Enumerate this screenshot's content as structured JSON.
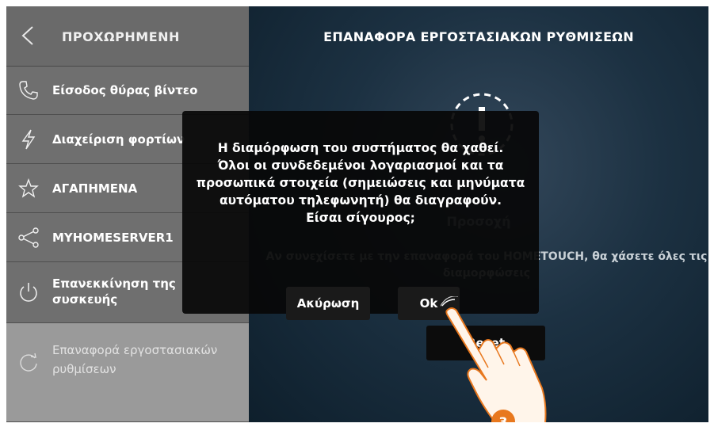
{
  "sidebar": {
    "title": "ΠΡΟΧΩΡΗΜΕΝΗ",
    "back_icon": "chevron-left-icon",
    "items": [
      {
        "label": "Είσοδος θύρας βίντεο",
        "icon": "phone-icon"
      },
      {
        "label": "Διαχείριση φορτίων",
        "icon": "lightning-icon"
      },
      {
        "label": "ΑΓΑΠΗΜΕΝΑ",
        "icon": "star-icon"
      },
      {
        "label": "MYHOMESERVER1",
        "icon": "share-icon"
      },
      {
        "label": "Επανεκκίνηση της συσκευής",
        "icon": "power-icon"
      },
      {
        "label": "Επαναφορά εργοστασιακών ρυθμίσεων",
        "icon": "reset-icon",
        "active": true
      }
    ]
  },
  "main": {
    "title": "ΕΠΑΝΑΦΟΡΑ ΕΡΓΟΣΤΑΣΙΑΚΩΝ ΡΥΘΜΙΣΕΩΝ",
    "caution_label": "Προσοχή",
    "description": "Αν συνεχίσετε με την επαναφορά του HOMETOUCH, θα χάσετε όλες τις διαμορφώσεις",
    "reset_button": "Reset",
    "warn_icon": "warning-icon"
  },
  "dialog": {
    "message": "Η διαμόρφωση του συστήματος θα χαθεί.\nΌλοι οι συνδεδεμένοι λογαριασμοί και τα προσωπικά στοιχεία (σημειώσεις και μηνύματα αυτόματου τηλεφωνητή) θα διαγραφούν.\nΕίσαι σίγουρος;",
    "cancel_label": "Ακύρωση",
    "ok_label": "Ok"
  },
  "step_badge": "3",
  "colors": {
    "sidebar_bg": "#6f6f6f",
    "sidebar_active": "#9a9a9a",
    "badge_orange": "#e8781e",
    "dialog_bg": "#080808"
  }
}
